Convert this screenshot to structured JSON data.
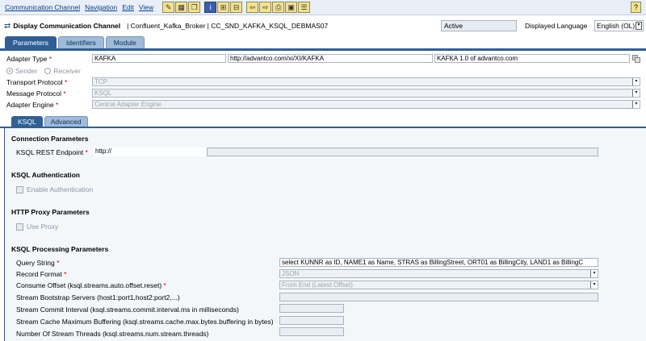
{
  "menu": {
    "items": [
      "Communication Channel",
      "Navigation",
      "Edit",
      "View"
    ],
    "help_glyph": "?"
  },
  "header": {
    "title": "Display Communication Channel",
    "object_path": "| Confluent_Kafka_Broker | CC_SND_KAFKA_KSQL_DEBMAS07",
    "status": "Active",
    "language_label": "Displayed Language",
    "language_value": "English (OL)"
  },
  "tabs": [
    "Parameters",
    "Identifiers",
    "Module"
  ],
  "params": {
    "adapter_type_label": "Adapter Type",
    "adapter_type_value": "KAFKA",
    "adapter_namespace": "http://advantco.com/xi/XI/KAFKA",
    "adapter_version": "KAFKA 1.0 of advantco.com",
    "sender_label": "Sender",
    "receiver_label": "Receiver",
    "transport_label": "Transport Protocol",
    "transport_value": "TCP",
    "message_label": "Message Protocol",
    "message_value": "KSQL",
    "engine_label": "Adapter Engine",
    "engine_value": "Central Adapter Engine"
  },
  "subtabs": [
    "KSQL",
    "Advanced"
  ],
  "ksql": {
    "connection_section": "Connection Parameters",
    "endpoint_label": "KSQL REST Endpoint",
    "endpoint_value": "http://",
    "auth_section": "KSQL Authentication",
    "enable_auth_label": "Enable Authentication",
    "proxy_section": "HTTP Proxy Parameters",
    "use_proxy_label": "Use Proxy",
    "processing_section": "KSQL Processing Parameters",
    "query_label": "Query String",
    "query_value": "select KUNNR as ID, NAME1 as Name, STRAS as BillingStreet, ORT01 as BillingCity, LAND1 as BillingC",
    "record_format_label": "Record Format",
    "record_format_value": "JSON",
    "consume_offset_label": "Consume Offset (ksql.streams.auto.offset.reset)",
    "consume_offset_value": "From End (Latest Offset)",
    "bootstrap_label": "Stream Bootstrap Servers (host1:port1,host2:port2,...)",
    "commit_label": "Stream Commit Interval (ksql.streams.commit.interval.ms in milliseconds)",
    "cache_label": "Stream Cache Maximum Buffering (ksql.streams.cache.max.bytes.buffering in bytes)",
    "threads_label": "Number Of Stream Threads (ksql.streams.num.stream.threads)"
  }
}
